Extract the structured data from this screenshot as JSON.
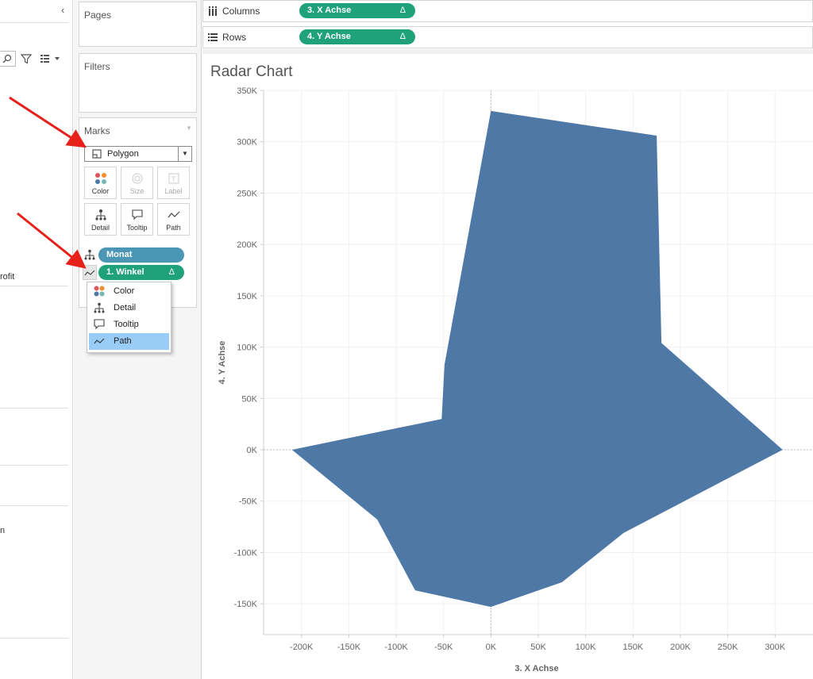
{
  "left_pane": {
    "fragment_1": "rofit",
    "fragment_2": "n"
  },
  "shelves": {
    "pages": "Pages",
    "filters": "Filters",
    "columns_label": "Columns",
    "rows_label": "Rows",
    "columns_pill": "3. X Achse",
    "rows_pill": "4. Y Achse",
    "delta": "Δ"
  },
  "marks": {
    "title": "Marks",
    "mark_type": "Polygon",
    "buttons": [
      "Color",
      "Size",
      "Label",
      "Detail",
      "Tooltip",
      "Path"
    ],
    "pills": [
      {
        "label": "Monat",
        "color": "#4a96b4"
      },
      {
        "label": "1. Winkel",
        "color": "#1fa27a",
        "delta": "Δ"
      }
    ]
  },
  "context_menu": {
    "items": [
      "Color",
      "Detail",
      "Tooltip",
      "Path"
    ],
    "selected": "Path"
  },
  "colors": {
    "polygon_fill": "#4e78a6",
    "green_pill": "#1fa27a",
    "blue_pill": "#4a96b4",
    "arrow": "#e8201a"
  },
  "chart_data": {
    "type": "area",
    "title": "Radar Chart",
    "xlabel": "3. X Achse",
    "ylabel": "4. Y Achse",
    "xlim": [
      -240000,
      340000
    ],
    "ylim": [
      -180000,
      350000
    ],
    "x_ticks": [
      -200000,
      -150000,
      -100000,
      -50000,
      0,
      50000,
      100000,
      150000,
      200000,
      250000,
      300000
    ],
    "x_tick_labels": [
      "-200K",
      "-150K",
      "-100K",
      "-50K",
      "0K",
      "50K",
      "100K",
      "150K",
      "200K",
      "250K",
      "300K"
    ],
    "y_ticks": [
      350000,
      300000,
      250000,
      200000,
      150000,
      100000,
      50000,
      0,
      -50000,
      -100000,
      -150000
    ],
    "y_tick_labels": [
      "350K",
      "300K",
      "250K",
      "200K",
      "150K",
      "100K",
      "50K",
      "0K",
      "-50K",
      "-100K",
      "-150K"
    ],
    "grid": true,
    "polygon": [
      {
        "x": 0,
        "y": 330000
      },
      {
        "x": 175000,
        "y": 306000
      },
      {
        "x": 180000,
        "y": 104000
      },
      {
        "x": 308000,
        "y": 0
      },
      {
        "x": 140000,
        "y": -81000
      },
      {
        "x": 75000,
        "y": -129000
      },
      {
        "x": 0,
        "y": -153000
      },
      {
        "x": -80000,
        "y": -137000
      },
      {
        "x": -120000,
        "y": -68000
      },
      {
        "x": -210000,
        "y": 0
      },
      {
        "x": -52000,
        "y": 30000
      },
      {
        "x": -49000,
        "y": 83000
      }
    ]
  }
}
